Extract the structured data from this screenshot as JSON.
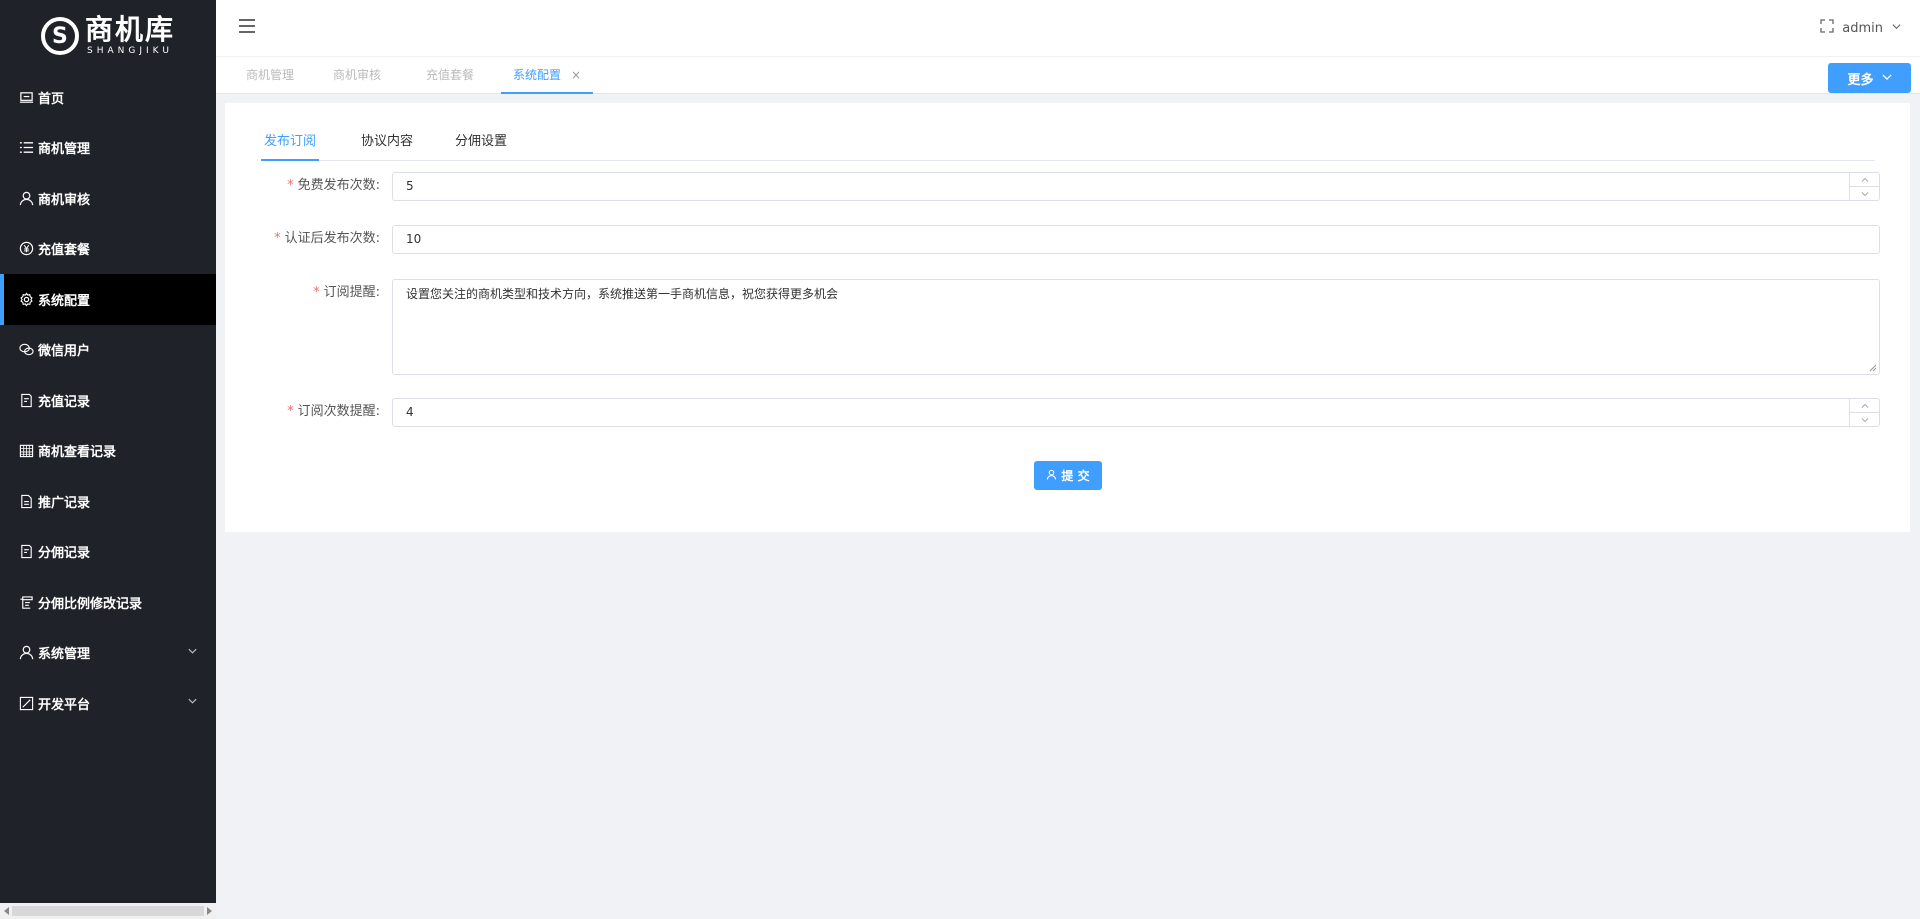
{
  "brand": {
    "cn": "商机库",
    "en": "SHANGJIKU",
    "mark": "S"
  },
  "sidebar": {
    "items": [
      {
        "label": "首页",
        "icon": "home-icon"
      },
      {
        "label": "商机管理",
        "icon": "list-icon"
      },
      {
        "label": "商机审核",
        "icon": "user-icon"
      },
      {
        "label": "充值套餐",
        "icon": "yen-icon"
      },
      {
        "label": "系统配置",
        "icon": "gear-icon",
        "active": true
      },
      {
        "label": "微信用户",
        "icon": "wechat-icon"
      },
      {
        "label": "充值记录",
        "icon": "receipt-icon"
      },
      {
        "label": "商机查看记录",
        "icon": "calendar-icon"
      },
      {
        "label": "推广记录",
        "icon": "document-icon"
      },
      {
        "label": "分佣记录",
        "icon": "receipt-icon"
      },
      {
        "label": "分佣比例修改记录",
        "icon": "scroll-icon"
      },
      {
        "label": "系统管理",
        "icon": "user-icon",
        "expandable": true
      },
      {
        "label": "开发平台",
        "icon": "edit-icon",
        "expandable": true
      }
    ]
  },
  "header": {
    "user": "admin"
  },
  "tabs": [
    {
      "label": "商机管理"
    },
    {
      "label": "商机审核"
    },
    {
      "label": "充值套餐"
    },
    {
      "label": "系统配置",
      "active": true,
      "close": "×"
    }
  ],
  "more_label": "更多",
  "content_tabs": [
    {
      "label": "发布订阅",
      "active": true
    },
    {
      "label": "协议内容"
    },
    {
      "label": "分佣设置"
    }
  ],
  "form": {
    "free_publish": {
      "label": "免费发布次数:",
      "value": "5"
    },
    "certified_publish": {
      "label": "认证后发布次数:",
      "value": "10"
    },
    "subscribe_tip": {
      "label": "订阅提醒:",
      "value": "设置您关注的商机类型和技术方向，系统推送第一手商机信息，祝您获得更多机会"
    },
    "subscribe_count_tip": {
      "label": "订阅次数提醒:",
      "value": "4"
    },
    "required_mark": "*",
    "submit_label": "提 交"
  },
  "colors": {
    "accent": "#409eff",
    "sidebar_bg": "#20222a",
    "required": "#f56c6c"
  }
}
